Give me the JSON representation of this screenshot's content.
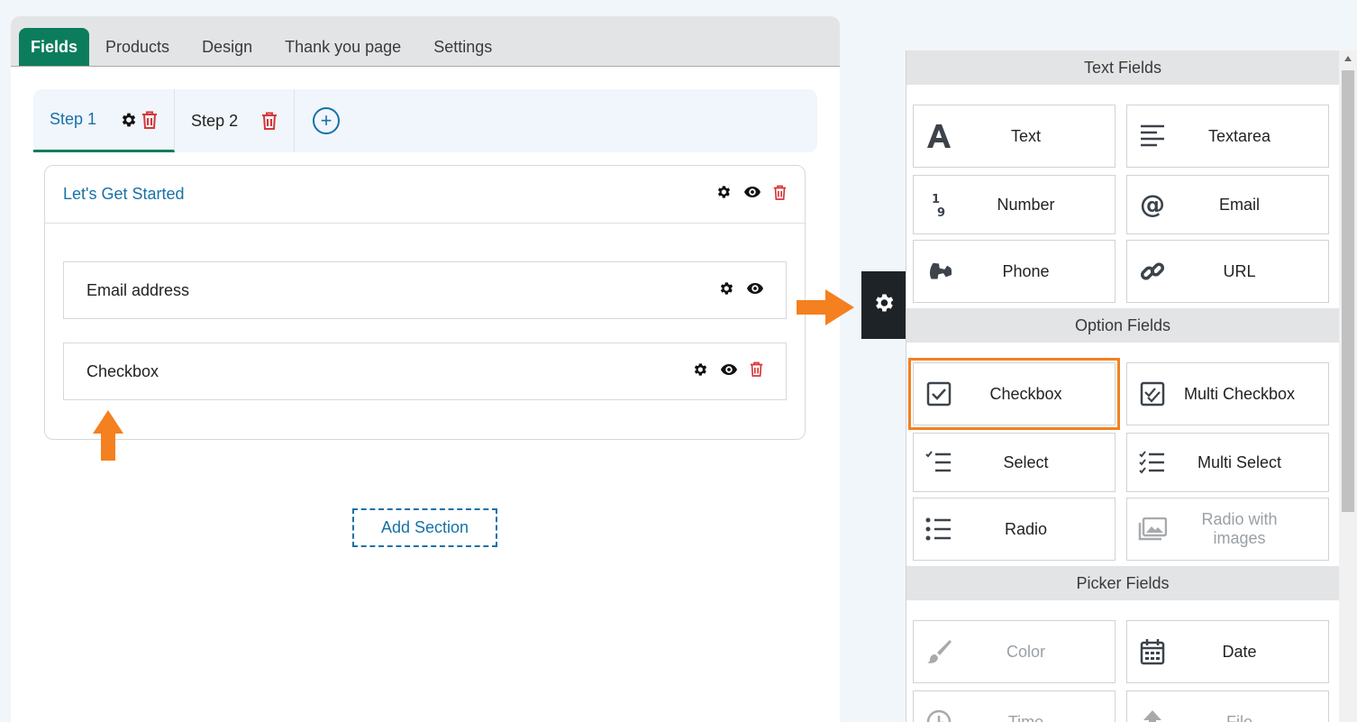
{
  "tabs": [
    "Fields",
    "Products",
    "Design",
    "Thank you page",
    "Settings"
  ],
  "steps": [
    {
      "label": "Step 1"
    },
    {
      "label": "Step 2"
    }
  ],
  "section": {
    "title": "Let's Get Started"
  },
  "fields": [
    {
      "name": "Email address"
    },
    {
      "name": "Checkbox"
    }
  ],
  "add_section_label": "Add Section",
  "panel": {
    "text_fields": {
      "title": "Text Fields",
      "items": [
        {
          "label": "Text",
          "icon": "text-icon"
        },
        {
          "label": "Textarea",
          "icon": "textarea-icon"
        },
        {
          "label": "Number",
          "icon": "number-icon"
        },
        {
          "label": "Email",
          "icon": "at-icon"
        },
        {
          "label": "Phone",
          "icon": "phone-icon"
        },
        {
          "label": "URL",
          "icon": "link-icon"
        }
      ]
    },
    "option_fields": {
      "title": "Option Fields",
      "items": [
        {
          "label": "Checkbox",
          "icon": "checkbox-icon"
        },
        {
          "label": "Multi Checkbox",
          "icon": "multi-checkbox-icon"
        },
        {
          "label": "Select",
          "icon": "select-icon"
        },
        {
          "label": "Multi Select",
          "icon": "multi-select-icon"
        },
        {
          "label": "Radio",
          "icon": "list-icon"
        },
        {
          "label": "Radio with images",
          "icon": "images-icon"
        }
      ]
    },
    "picker_fields": {
      "title": "Picker Fields",
      "items": [
        {
          "label": "Color",
          "icon": "brush-icon"
        },
        {
          "label": "Date",
          "icon": "calendar-icon"
        },
        {
          "label": "Time",
          "icon": "clock-icon"
        },
        {
          "label": "File",
          "icon": "upload-icon"
        }
      ]
    }
  },
  "colors": {
    "accent": "#0b7d5c",
    "link": "#1771a8",
    "danger": "#d63638",
    "highlight": "#f4801f"
  }
}
